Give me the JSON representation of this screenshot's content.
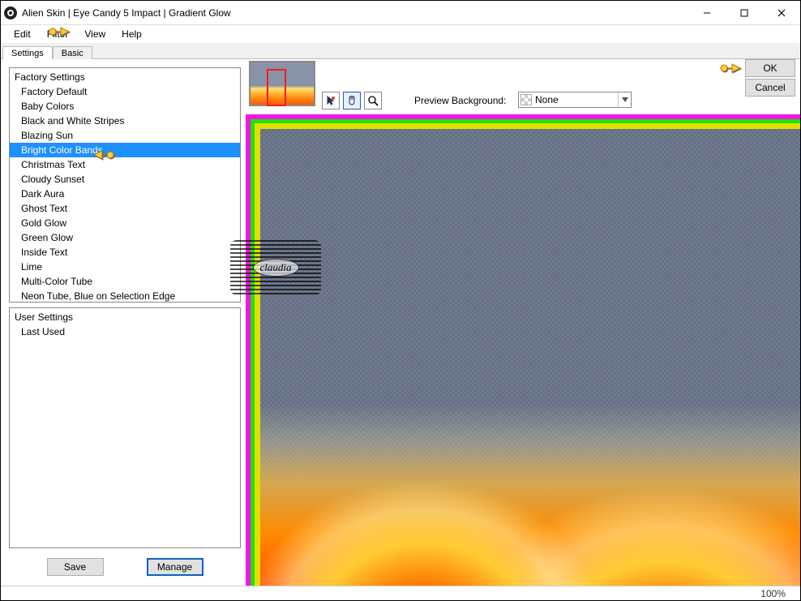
{
  "titlebar": {
    "title": "Alien Skin | Eye Candy 5 Impact | Gradient Glow"
  },
  "menu": {
    "edit": "Edit",
    "filter": "Filter",
    "view": "View",
    "help": "Help"
  },
  "tabs": {
    "settings": "Settings",
    "basic": "Basic"
  },
  "factory": {
    "header": "Factory Settings",
    "items": [
      "Factory Default",
      "Baby Colors",
      "Black and White Stripes",
      "Blazing Sun",
      "Bright Color Bands",
      "Christmas Text",
      "Cloudy Sunset",
      "Dark Aura",
      "Ghost Text",
      "Gold Glow",
      "Green Glow",
      "Inside Text",
      "Lime",
      "Multi-Color Tube",
      "Neon Tube, Blue on Selection Edge"
    ],
    "selected_index": 4
  },
  "user": {
    "header": "User Settings",
    "items": [
      "Last Used"
    ]
  },
  "buttons": {
    "save": "Save",
    "manage": "Manage",
    "ok": "OK",
    "cancel": "Cancel"
  },
  "preview": {
    "label": "Preview Background:",
    "value": "None"
  },
  "icons": {
    "pointer": "pointer-icon",
    "hand": "hand-icon",
    "zoom": "zoom-icon"
  },
  "watermark": "claudia",
  "status": {
    "zoom": "100%"
  }
}
